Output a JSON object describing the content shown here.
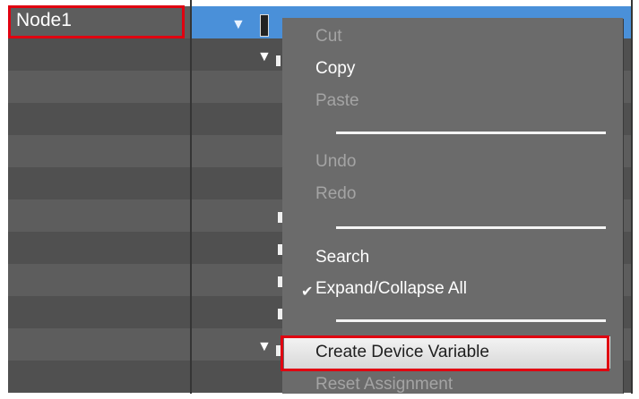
{
  "tree": {
    "node_label": "Node1"
  },
  "context_menu": {
    "items": [
      {
        "label": "Cut",
        "enabled": false
      },
      {
        "label": "Copy",
        "enabled": true
      },
      {
        "label": "Paste",
        "enabled": false
      },
      {
        "label": "Undo",
        "enabled": false
      },
      {
        "label": "Redo",
        "enabled": false
      },
      {
        "label": "Search",
        "enabled": true
      },
      {
        "label": "Expand/Collapse All",
        "enabled": true,
        "checked": true
      },
      {
        "label": "Create Device Variable",
        "enabled": true,
        "hovered": true
      },
      {
        "label": "Reset Assignment",
        "enabled": false
      }
    ],
    "check_glyph": "✔"
  },
  "icons": {
    "expand": "▼"
  },
  "colors": {
    "highlight_border": "#e00010",
    "selection_blue": "#4a90d9",
    "menu_bg": "#6b6b6b"
  }
}
